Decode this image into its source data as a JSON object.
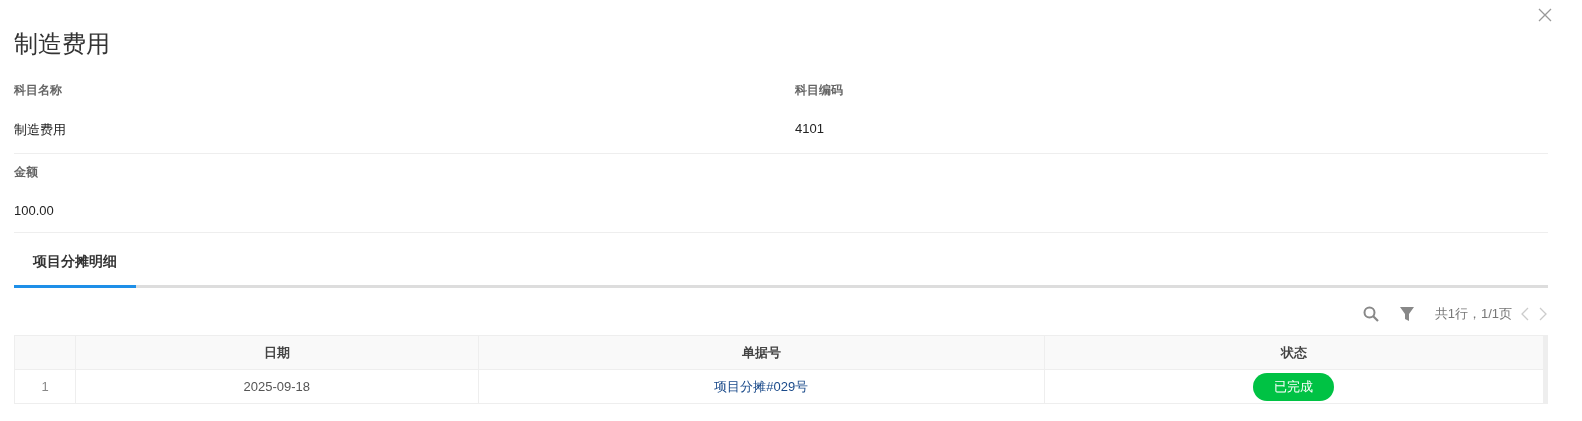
{
  "title": "制造费用",
  "fields": [
    [
      {
        "label": "科目名称",
        "value": "制造费用"
      },
      {
        "label": "科目编码",
        "value": "4101"
      }
    ],
    [
      {
        "label": "金额",
        "value": "100.00"
      }
    ]
  ],
  "tabs": [
    {
      "label": "项目分摊明细",
      "selected": true
    }
  ],
  "pager": {
    "summary": "共1行，1/1页",
    "prev_disabled": true,
    "next_disabled": true
  },
  "table": {
    "columns": [
      "日期",
      "单据号",
      "状态"
    ],
    "rows": [
      {
        "index": "1",
        "date": "2025-09-18",
        "doc": "项目分摊#029号",
        "status": "已完成"
      }
    ]
  }
}
